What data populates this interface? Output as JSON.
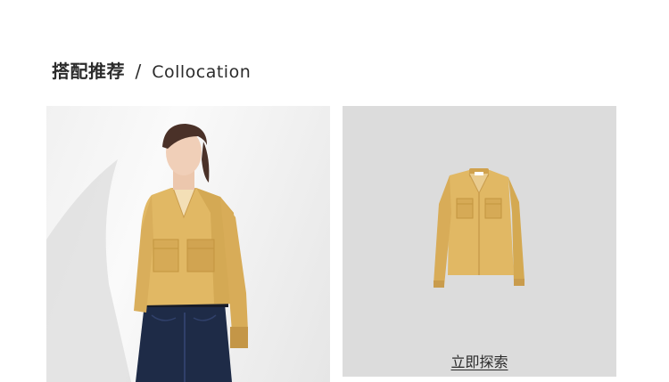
{
  "section": {
    "title_cn": "搭配推荐",
    "separator": "/",
    "title_en": "Collocation"
  },
  "model_card": {
    "image": "model wearing gold silk blouse and dark blue jeans"
  },
  "product_card": {
    "image": "gold silk long-sleeve blouse product shot",
    "cta": "立即探索"
  },
  "colors": {
    "blouse": "#e1b864",
    "product_bg": "#dcdcdc",
    "jeans": "#1e2b47",
    "hair": "#4a3128"
  }
}
